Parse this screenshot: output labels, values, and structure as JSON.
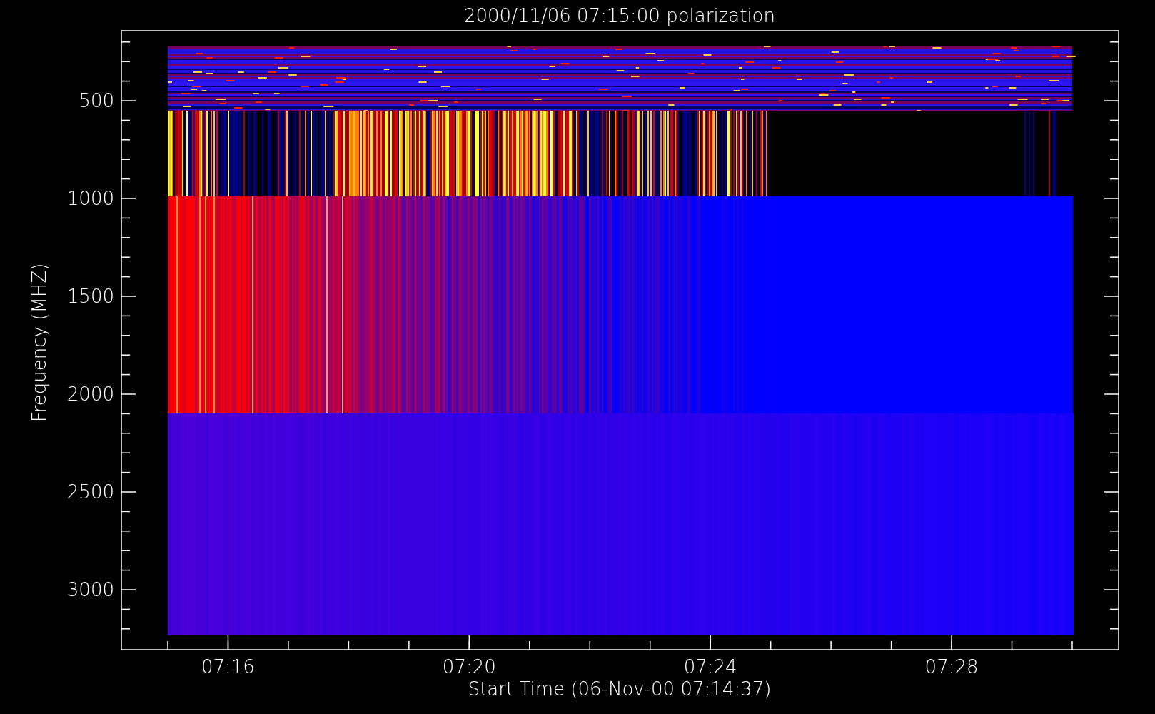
{
  "title": "2000/11/06 07:15:00 polarization",
  "y_axis": {
    "label": "Frequency (MHZ)",
    "ticks": [
      "500",
      "1000",
      "1500",
      "2000",
      "2500",
      "3000"
    ]
  },
  "x_axis": {
    "label": "Start Time (06-Nov-00 07:14:37)",
    "ticks": [
      "07:16",
      "07:20",
      "07:24",
      "07:28"
    ]
  }
}
